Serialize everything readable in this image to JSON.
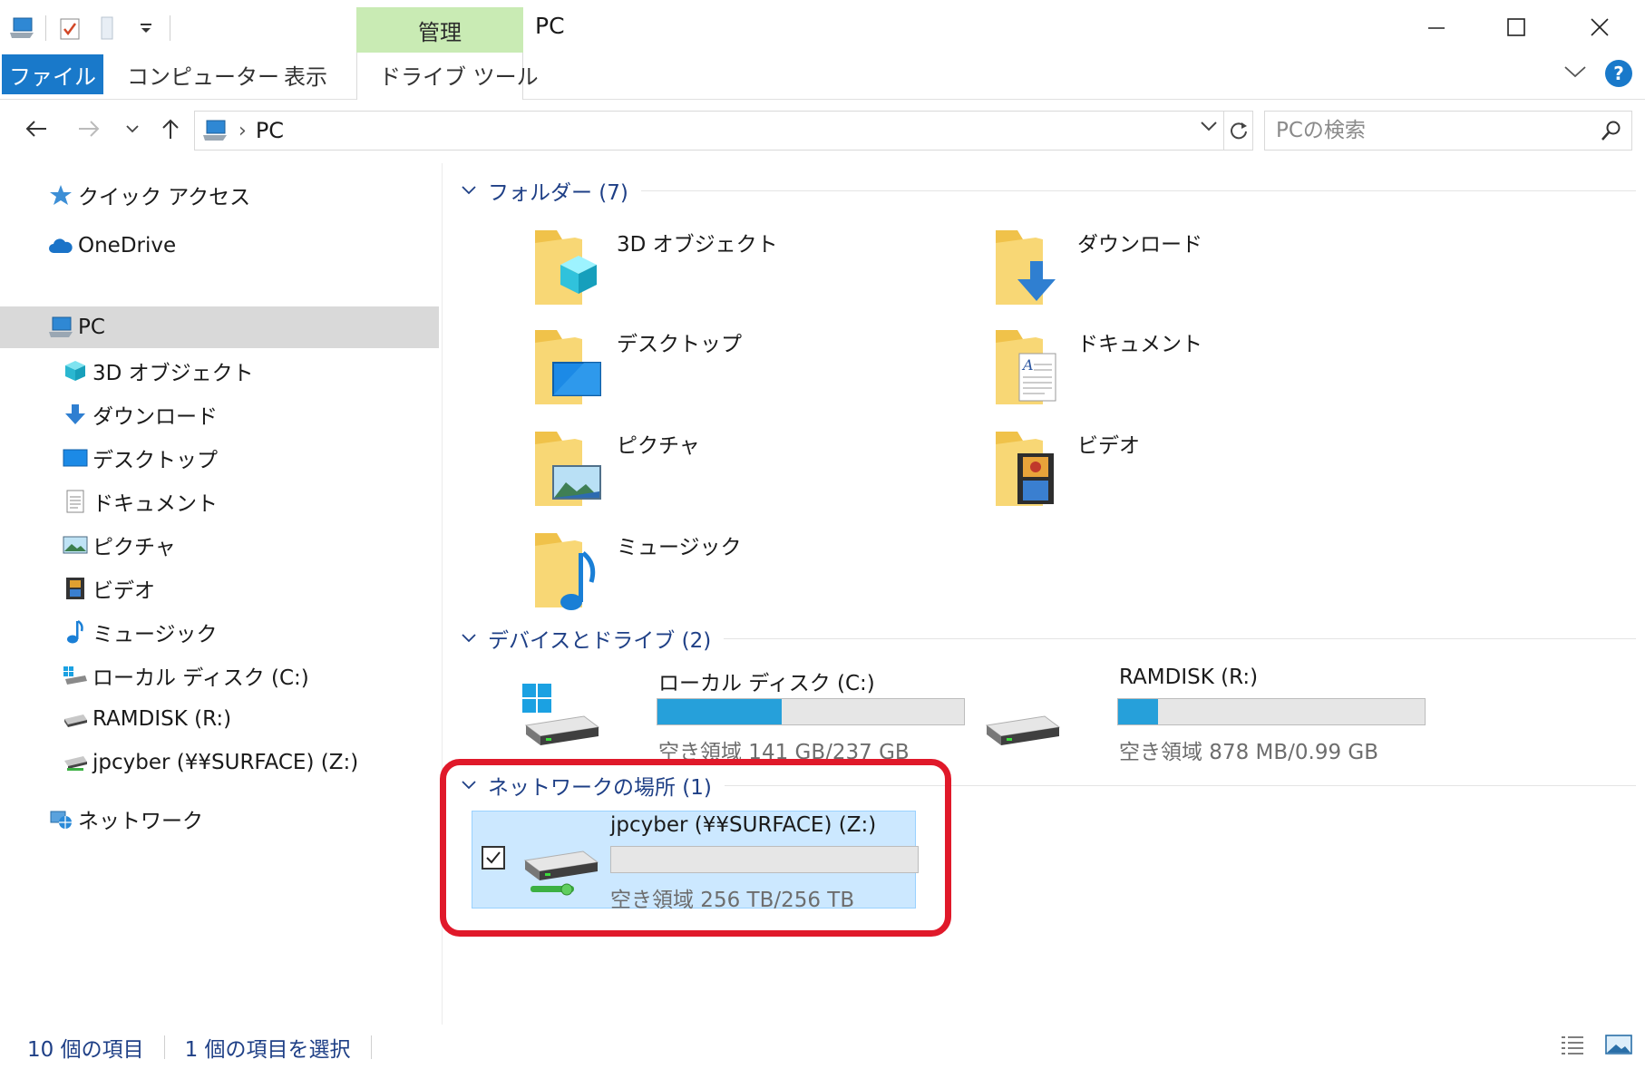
{
  "window": {
    "title": "PC",
    "context_tab_group": "管理",
    "controls": [
      "minimize",
      "maximize",
      "close"
    ]
  },
  "ribbon": {
    "tabs": [
      {
        "label": "ファイル",
        "active": true
      },
      {
        "label": "コンピューター"
      },
      {
        "label": "表示"
      },
      {
        "label": "ドライブ ツール"
      }
    ],
    "help": "?"
  },
  "address": {
    "crumbs": [
      "PC"
    ],
    "search_placeholder": "PCの検索"
  },
  "sidebar": {
    "items": [
      {
        "label": "クイック アクセス",
        "icon": "star-icon",
        "level": 0
      },
      {
        "label": "OneDrive",
        "icon": "cloud-icon",
        "level": 0
      },
      {
        "label": "PC",
        "icon": "computer-icon",
        "level": 0,
        "selected": true
      },
      {
        "label": "3D オブジェクト",
        "icon": "cube-icon",
        "level": 1
      },
      {
        "label": "ダウンロード",
        "icon": "download-arrow-icon",
        "level": 1
      },
      {
        "label": "デスクトップ",
        "icon": "desktop-icon",
        "level": 1
      },
      {
        "label": "ドキュメント",
        "icon": "document-icon",
        "level": 1
      },
      {
        "label": "ピクチャ",
        "icon": "picture-icon",
        "level": 1
      },
      {
        "label": "ビデオ",
        "icon": "video-icon",
        "level": 1
      },
      {
        "label": "ミュージック",
        "icon": "music-note-icon",
        "level": 1
      },
      {
        "label": "ローカル ディスク (C:)",
        "icon": "windows-drive-icon",
        "level": 1
      },
      {
        "label": "RAMDISK (R:)",
        "icon": "drive-icon",
        "level": 1
      },
      {
        "label": "jpcyber (¥¥SURFACE) (Z:)",
        "icon": "network-drive-icon",
        "level": 1
      },
      {
        "label": "ネットワーク",
        "icon": "network-icon",
        "level": 0
      }
    ]
  },
  "content": {
    "folders_header": "フォルダー (7)",
    "folders": [
      {
        "label": "3D オブジェクト",
        "icon": "cube-folder-icon"
      },
      {
        "label": "ダウンロード",
        "icon": "download-folder-icon"
      },
      {
        "label": "デスクトップ",
        "icon": "desktop-folder-icon"
      },
      {
        "label": "ドキュメント",
        "icon": "document-folder-icon"
      },
      {
        "label": "ピクチャ",
        "icon": "picture-folder-icon"
      },
      {
        "label": "ビデオ",
        "icon": "video-folder-icon"
      },
      {
        "label": "ミュージック",
        "icon": "music-folder-icon"
      }
    ],
    "devices_header": "デバイスとドライブ (2)",
    "devices": [
      {
        "name": "ローカル ディスク (C:)",
        "free": "空き領域 141 GB/237 GB",
        "used_fraction": 0.405,
        "icon": "windows-drive-icon"
      },
      {
        "name": "RAMDISK (R:)",
        "free": "空き領域 878 MB/0.99 GB",
        "used_fraction": 0.13,
        "icon": "drive-icon"
      }
    ],
    "network_header": "ネットワークの場所 (1)",
    "network": [
      {
        "name": "jpcyber (¥¥SURFACE) (Z:)",
        "free": "空き領域 256 TB/256 TB",
        "used_fraction": 0.0,
        "icon": "network-drive-icon",
        "selected": true,
        "checked": true
      }
    ]
  },
  "status": {
    "item_count": "10 個の項目",
    "selection": "1 個の項目を選択"
  },
  "colors": {
    "accent": "#1979ca",
    "context_tab": "#c9ebb4",
    "group_header": "#1e3f86",
    "selection_bg": "#cce8ff",
    "bar_fill": "#26a0da",
    "highlight": "#e0192a"
  }
}
